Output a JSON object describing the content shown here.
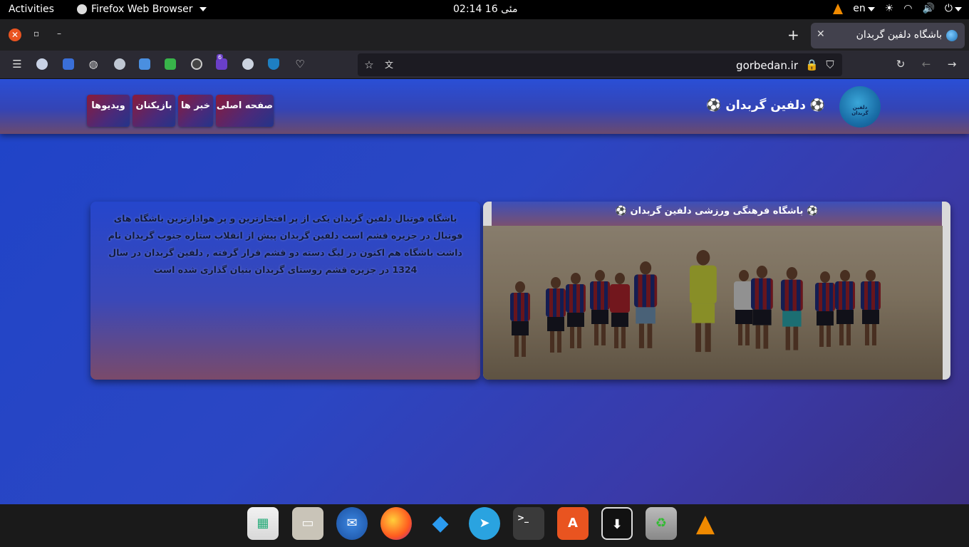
{
  "topbar": {
    "activities": "Activities",
    "app_name": "Firefox Web Browser",
    "clock": "02:14  16 مئی",
    "lang": "en"
  },
  "browser": {
    "tab_title": "باشگاه دلفین گربدان",
    "url": "gorbedan.ir",
    "extension_badge": "6"
  },
  "site": {
    "logo_text": "دلفین گربدان",
    "title": "⚽ دلفین گربدان ⚽",
    "nav": {
      "home": "صفحه اصلی",
      "news": "خبر ها",
      "players": "بازیکنان",
      "videos": "ویدیوها"
    },
    "intro": "باشگاه فوتبال دلفین گربدان یکی از پر افتخارترین و پر هوادارترین باشگاه های فوتبال در جزیره قشم است دلفین گربدان پیش از انقلاب ستاره جنوب گربدان نام داشت باشگاه هم اکنون در لیگ دسته دو قشم قرار گرفته , دلفین گربدان در سال 1324 در جزیره قشم روستای گربدان بنیان گذاری شده است",
    "photo_caption": "⚽ باشگاه فرهنگی ورزشی دلفین گربدان ⚽"
  },
  "colors": {
    "accent": "#e95420",
    "page_bg": "#2b46c3",
    "nav_button": "#8a1b3a"
  }
}
